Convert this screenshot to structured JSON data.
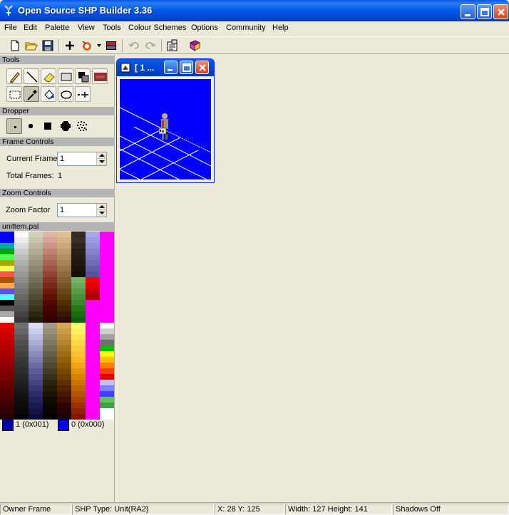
{
  "window": {
    "title": "Open Source SHP Builder 3.36"
  },
  "menu": [
    "File",
    "Edit",
    "Palette",
    "View",
    "Tools",
    "Colour Schemes",
    "Options",
    "Community",
    "Help"
  ],
  "sections": {
    "tools": "Tools",
    "dropper": "Dropper",
    "frame_controls": "Frame Controls",
    "zoom_controls": "Zoom Controls",
    "palette_name": "unittem.pal"
  },
  "frame": {
    "current_label": "Current Frame",
    "current_value": "1",
    "total_label": "Total Frames:",
    "total_value": "1"
  },
  "zoom": {
    "label": "Zoom Factor",
    "value": "1"
  },
  "colors": {
    "active_left": {
      "label": "1 (0x001)",
      "hex": "#0000aa"
    },
    "active_right": {
      "label": "0 (0x000)",
      "hex": "#0000fc"
    }
  },
  "child_window": {
    "title": "[ 1 ..."
  },
  "status": {
    "mode": "Owner Frame",
    "shp_type": "SHP Type: Unit(RA2)",
    "coords": "X: 28 Y: 125",
    "size": "Width: 127 Height: 141",
    "shadows": "Shadows Off"
  },
  "palette_columns": [
    [
      "#0000fc",
      "#0000fc",
      "#00a8a8",
      "#00a800",
      "#54fc54",
      "#a8a800",
      "#fcfc54",
      "#fc5454",
      "#a85400",
      "#fca854",
      "#5454fc",
      "#54fcfc",
      "#000000",
      "#545454",
      "#a8a8a8",
      "#fcfcfc",
      "#e40000",
      "#d80000",
      "#cc0000",
      "#c00000",
      "#b40000",
      "#a80000",
      "#9c0000",
      "#900000",
      "#840000",
      "#780000",
      "#6c0000",
      "#600000",
      "#540000",
      "#480000",
      "#3c0000",
      "#300000",
      "#240000"
    ],
    [
      "#fcfcfc",
      "#ececec",
      "#dcdcdc",
      "#cccccc",
      "#bcbcbc",
      "#b0b0b0",
      "#a4a4a4",
      "#989898",
      "#8c8c8c",
      "#808080",
      "#747474",
      "#686868",
      "#5c5c5c",
      "#505050",
      "#444444",
      "#383838",
      "#707070",
      "#646464",
      "#5a5a5a",
      "#505050",
      "#484848",
      "#404040",
      "#383838",
      "#323232",
      "#2c2c2c",
      "#262626",
      "#202020",
      "#1a1a1a",
      "#141414",
      "#101010",
      "#0c0c0c",
      "#080808",
      "#040404"
    ],
    [
      "#d4d0c0",
      "#c8c4b0",
      "#bcb8a0",
      "#b0ac94",
      "#a4a088",
      "#98947c",
      "#8c8870",
      "#807c64",
      "#747058",
      "#68644c",
      "#5c5840",
      "#504c34",
      "#444028",
      "#38341c",
      "#2c2810",
      "#201c08",
      "#dcdcf4",
      "#ccccec",
      "#bcbce0",
      "#acacd4",
      "#9c9cc8",
      "#8c8cbc",
      "#7c7cb0",
      "#6c6ca4",
      "#5c5c98",
      "#50508c",
      "#444480",
      "#383874",
      "#2c2c68",
      "#24245c",
      "#1c1c50",
      "#141444",
      "#0c0c38"
    ],
    [
      "#e4b4a4",
      "#d8a494",
      "#cc9484",
      "#c08474",
      "#b47464",
      "#a86454",
      "#9c5444",
      "#904434",
      "#843424",
      "#782818",
      "#6c1c0c",
      "#601000",
      "#540800",
      "#480400",
      "#3c0000",
      "#300000",
      "#a09c88",
      "#94907c",
      "#888470",
      "#7c7864",
      "#706c58",
      "#64604c",
      "#585440",
      "#4c4834",
      "#403c28",
      "#34301c",
      "#282410",
      "#201c08",
      "#181404",
      "#100c00",
      "#0c0800",
      "#080400",
      "#040000"
    ],
    [
      "#e0c090",
      "#d4b484",
      "#c8a878",
      "#bc9c6c",
      "#b09060",
      "#a48454",
      "#987848",
      "#8c6c3c",
      "#806030",
      "#745424",
      "#684818",
      "#5c3c0c",
      "#503000",
      "#442400",
      "#381800",
      "#2c0c00",
      "#d8a850",
      "#cc9c44",
      "#c09038",
      "#b4842c",
      "#a87820",
      "#9c6c14",
      "#906008",
      "#845400",
      "#784800",
      "#6c3c00",
      "#603000",
      "#542400",
      "#481800",
      "#3c0c00",
      "#300000",
      "#240000",
      "#180000"
    ],
    [
      "#302c24",
      "#383028",
      "#2c281c",
      "#242018",
      "#201c14",
      "#1c1810",
      "#18140c",
      "#141008",
      "#78b468",
      "#68a858",
      "#589c48",
      "#489038",
      "#388428",
      "#287818",
      "#1c6c0c",
      "#106000",
      "#fcfc6c",
      "#fcf060",
      "#fce454",
      "#fcd848",
      "#fccc3c",
      "#fcc030",
      "#fcb424",
      "#f0a418",
      "#e4940c",
      "#d88400",
      "#cc7400",
      "#c06400",
      "#b45400",
      "#a84400",
      "#9c3400",
      "#902400",
      "#841400"
    ],
    [
      "#a8a8f0",
      "#9c9ce4",
      "#9090d8",
      "#8484cc",
      "#7878c0",
      "#6c6cb4",
      "#6060a8",
      "#54549c",
      "#fc0000",
      "#e00000",
      "#c40000",
      "#a80000",
      "#fc00fc",
      "#fc00fc",
      "#fc00fc",
      "#fc00fc",
      "#fc00fc",
      "#fc00fc",
      "#fc00fc",
      "#fc00fc",
      "#fc00fc",
      "#fc00fc",
      "#fc00fc",
      "#fc00fc",
      "#fc00fc",
      "#fc00fc",
      "#fc00fc",
      "#fc00fc",
      "#fc00fc",
      "#fc00fc",
      "#fc00fc",
      "#fc00fc",
      "#fc00fc"
    ],
    [
      "#fc00fc",
      "#fc00fc",
      "#fc00fc",
      "#fc00fc",
      "#fc00fc",
      "#fc00fc",
      "#fc00fc",
      "#fc00fc",
      "#fc00fc",
      "#fc00fc",
      "#fc00fc",
      "#fc00fc",
      "#fc00fc",
      "#fc00fc",
      "#fc00fc",
      "#fc00fc",
      "#ffffff",
      "#d0d0d0",
      "#a0a0a0",
      "#707070",
      "#00c000",
      "#fcfc00",
      "#fcc000",
      "#fc8000",
      "#fc4000",
      "#e00000",
      "#c0c0fc",
      "#8080fc",
      "#4040fc",
      "#60c060",
      "#40a040",
      "#ffffff",
      "#ffffff"
    ]
  ]
}
